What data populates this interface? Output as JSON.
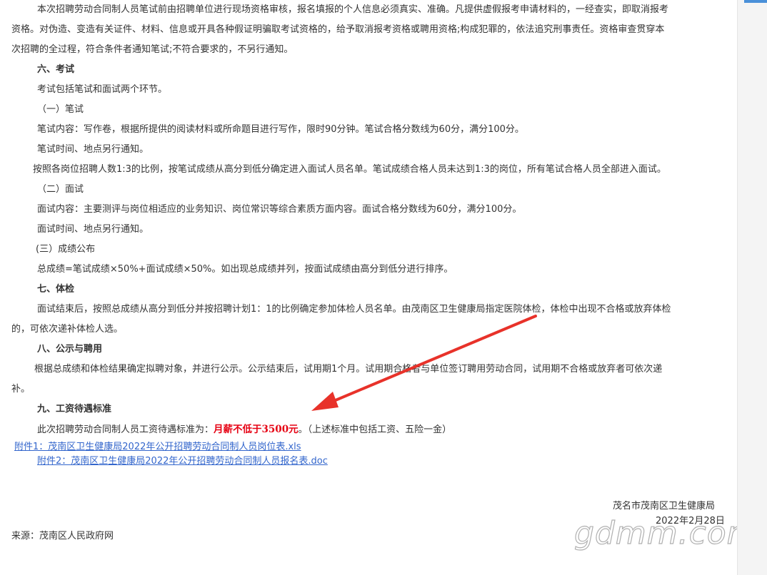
{
  "paragraphs": {
    "qual_1": "本次招聘劳动合同制人员笔试前由招聘单位进行现场资格审核，报名填报的个人信息必须真实、准确。凡提供虚假报考申请材料的，一经查实，即取消报考",
    "qual_2": "资格。对伪造、变造有关证件、材料、信息或开具各种假证明骗取考试资格的，给予取消报考资格或聘用资格;构成犯罪的，依法追究刑事责任。资格审查贯穿本",
    "qual_3": "次招聘的全过程，符合条件者通知笔试;不符合要求的，不另行通知。",
    "h6": "六、考试",
    "exam_intro": "考试包括笔试和面试两个环节。",
    "written_title": "（一）笔试",
    "written_content": "笔试内容：写作卷，根据所提供的阅读材料或所命题目进行写作，限时90分钟。笔试合格分数线为60分，满分100分。",
    "written_time": "笔试时间、地点另行通知。",
    "written_ratio": "按照各岗位招聘人数1:3的比例，按笔试成绩从高分到低分确定进入面试人员名单。笔试成绩合格人员未达到1:3的岗位，所有笔试合格人员全部进入面试。",
    "interview_title": "（二）面试",
    "interview_content": "面试内容：主要测评与岗位相适应的业务知识、岗位常识等综合素质方面内容。面试合格分数线为60分，满分100分。",
    "interview_time": "面试时间、地点另行通知。",
    "score_title": "(三）成绩公布",
    "score_content": "总成绩=笔试成绩×50%+面试成绩×50%。如出现总成绩并列，按面试成绩由高分到低分进行排序。",
    "h7": "七、体检",
    "physical_1": "面试结束后，按照总成绩从高分到低分并按招聘计划1：1的比例确定参加体检人员名单。由茂南区卫生健康局指定医院体检，体检中出现不合格或放弃体检",
    "physical_2": "的，可依次递补体检人选。",
    "h8": "八、公示与聘用",
    "hire_1": "根据总成绩和体检结果确定拟聘对象，并进行公示。公示结束后，试用期1个月。试用期合格者与单位签订聘用劳动合同，试用期不合格或放弃者可依次递",
    "hire_2": "补。",
    "h9": "九、工资待遇标准",
    "salary_pre": "此次招聘劳动合同制人员工资待遇标准为：",
    "salary_value": "月薪不低于3500元",
    "salary_post": "。（上述标准中包括工资、五险一金）"
  },
  "attachments": [
    "附件1：茂南区卫生健康局2022年公开招聘劳动合同制人员岗位表.xls",
    "附件2：茂南区卫生健康局2022年公开招聘劳动合同制人员报名表.doc"
  ],
  "footer": {
    "org": "茂名市茂南区卫生健康局",
    "date": "2022年2月28日",
    "source": "来源：茂南区人民政府网"
  },
  "watermark": "gdmm.com",
  "colors": {
    "highlight": "#e60012",
    "link": "#3366cc",
    "arrow": "#e8322a"
  }
}
